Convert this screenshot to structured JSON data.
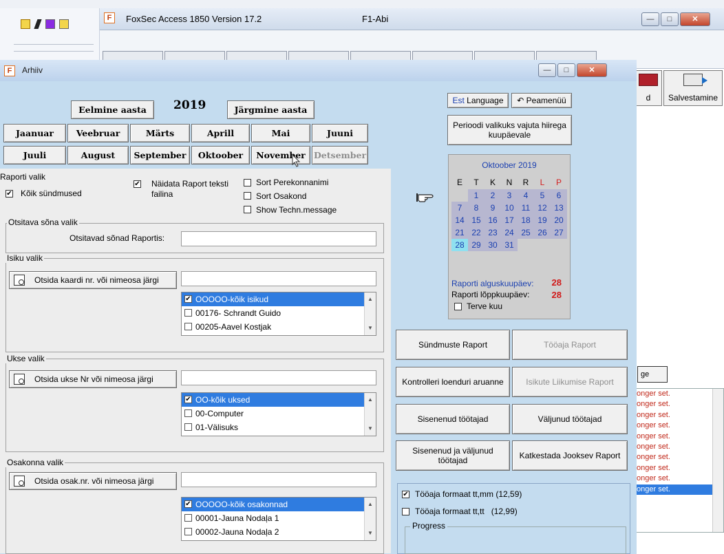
{
  "background": {
    "fox_title": "FoxSec Access 1850  Version 17.2",
    "fox_user": "F1-Abi",
    "fox_icon_letter": "F",
    "right_buttons": [
      {
        "label": "d"
      },
      {
        "label": "Salvestamine"
      }
    ],
    "ge_label": "ge",
    "log_lines": [
      "onger set.",
      "onger set.",
      "onger set.",
      "onger set.",
      "onger set.",
      "onger set.",
      "onger set.",
      "onger set.",
      "onger set.",
      "onger set."
    ]
  },
  "dialog": {
    "title": "Arhiiv",
    "icon_letter": "F",
    "prev_year": "Eelmine aasta",
    "year": "2019",
    "next_year": "Järgmine aasta",
    "months_row1": [
      "Jaanuar",
      "Veebruar",
      "Märts",
      "Aprill",
      "Mai",
      "Juuni"
    ],
    "months_row2": [
      "Juuli",
      "August",
      "September",
      "Oktoober",
      "November",
      "Detsember"
    ],
    "lang_est": "Est",
    "lang_language": "Language",
    "peamenuu": "Peamenüü",
    "period_hint": "Perioodi valikuks vajuta hiirega kuupäevale"
  },
  "report_choice": {
    "legend": "Raporti valik",
    "all_events": "Kõik sündmused",
    "show_text_file": "Näidata Raport teksti failina",
    "sort_family": "Sort Perekonnanimi",
    "sort_dept": "Sort Osakond",
    "show_techn": "Show Techn.message"
  },
  "search_words": {
    "legend": "Otsitava sõna valik",
    "label": "Otsitavad sõnad Raportis:"
  },
  "person": {
    "legend": "Isiku valik",
    "button": "Otsida kaardi nr. või nimeosa järgi",
    "items": [
      "OOOOO-kõik isikud",
      "00176- Schrandt Guido",
      "00205-Aavel Kostjak"
    ]
  },
  "door": {
    "legend": "Ukse valik",
    "button": "Otsida ukse Nr või nimeosa järgi",
    "items": [
      "OO-kõik uksed",
      "00-Computer",
      "01-Välisuks"
    ]
  },
  "dept": {
    "legend": "Osakonna valik",
    "button": "Otsida osak.nr. või nimeosa järgi",
    "items": [
      "OOOOO-kõik osakonnad",
      "00001-Jauna Nodaļa 1",
      "00002-Jauna Nodaļa 2"
    ]
  },
  "calendar": {
    "title": "Oktoober 2019",
    "weekdays": [
      "E",
      "T",
      "K",
      "N",
      "R",
      "L",
      "P"
    ],
    "weeks": [
      [
        "",
        "1",
        "2",
        "3",
        "4",
        "5",
        "6"
      ],
      [
        "7",
        "8",
        "9",
        "10",
        "11",
        "12",
        "13"
      ],
      [
        "14",
        "15",
        "16",
        "17",
        "18",
        "19",
        "20"
      ],
      [
        "21",
        "22",
        "23",
        "24",
        "25",
        "26",
        "27"
      ],
      [
        "28",
        "29",
        "30",
        "31",
        "",
        "",
        ""
      ]
    ],
    "selected_day": "28",
    "start_label": "Raporti alguskuupäev:",
    "start_value": "28",
    "end_label": "Raporti lõppkuupäev:",
    "end_value": "28",
    "whole_month": "Terve kuu"
  },
  "reports": {
    "events": "Sündmuste Raport",
    "worktime": "Tööaja Raport",
    "controller_counter": "Kontrolleri loenduri aruanne",
    "person_movement": "Isikute Liikumise Raport",
    "entered": "Sisenenud töötajad",
    "exited": "Väljunud töötajad",
    "entered_exited": "Sisenenud ja väljunud töötajad",
    "abort": "Katkestada Jooksev Raport"
  },
  "format": {
    "hhmm": "Tööaja formaat tt,mm (12,59)",
    "hhtt": "Tööaja formaat tt,tt   (12,99)"
  },
  "progress": {
    "label": "Progress"
  }
}
